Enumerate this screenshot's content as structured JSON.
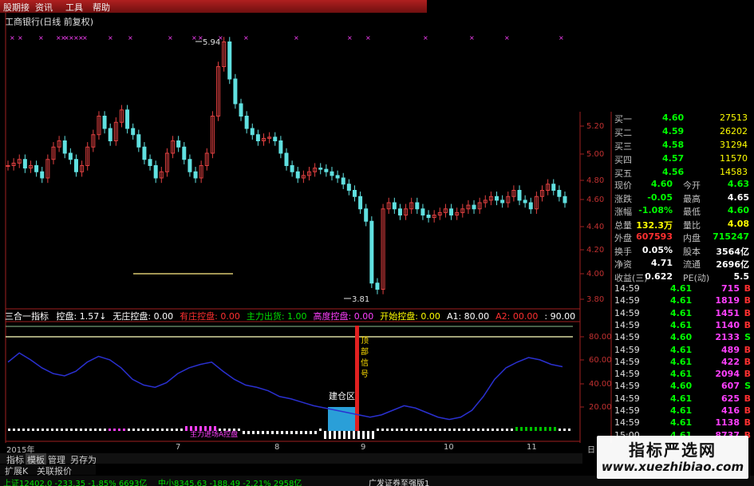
{
  "menu": [
    "股期接",
    "资讯",
    "工具",
    "帮助"
  ],
  "chart": {
    "title": "工商银行(日线 前复权)",
    "price_axis": [
      "5.20",
      "5.00",
      "4.80",
      "4.60",
      "4.40",
      "4.20",
      "4.00",
      "3.80"
    ],
    "high_label": "5.94",
    "low_label": "3.81"
  },
  "indicator": {
    "name": "三合一指标",
    "items": [
      {
        "text": "控盘: 1.57↓",
        "color": "#ffffff"
      },
      {
        "text": "无庄控盘: 0.00",
        "color": "#ffffff"
      },
      {
        "text": "有庄控盘: 0.00",
        "color": "#ff3030"
      },
      {
        "text": "主力出货: 1.00",
        "color": "#00e000"
      },
      {
        "text": "高度控盘: 0.00",
        "color": "#ff40ff"
      },
      {
        "text": "开始控盘: 0.00",
        "color": "#ffff00"
      },
      {
        "text": "A1: 80.00",
        "color": "#ffffff"
      },
      {
        "text": "A2: 00.00",
        "color": "#ff3030"
      },
      {
        "text": ": 90.00",
        "color": "#ffffff"
      }
    ],
    "axis": [
      "80.00",
      "60.00",
      "40.00",
      "20.00"
    ],
    "label_build": "建仓区",
    "label_top": "顶部信号",
    "label_main": "主力进场A控盘"
  },
  "xaxis": [
    "2015年",
    "7",
    "8",
    "9",
    "10",
    "11",
    "日"
  ],
  "bottom_tabs": [
    "指标",
    "模板",
    "管理",
    "另存为"
  ],
  "sub_tabs": [
    "扩展K",
    "关联报价"
  ],
  "status": {
    "sh": "上证12402.0 -233.35 -1.85% 6693亿",
    "sz": "中小8345.63 -188.49 -2.21% 2958亿",
    "broker": "广发证券至强版1"
  },
  "quote": {
    "bids": [
      {
        "label": "买一",
        "price": "4.60",
        "vol": "27513"
      },
      {
        "label": "买二",
        "price": "4.59",
        "vol": "26202"
      },
      {
        "label": "买三",
        "price": "4.58",
        "vol": "31294"
      },
      {
        "label": "买四",
        "price": "4.57",
        "vol": "11570"
      },
      {
        "label": "买五",
        "price": "4.56",
        "vol": "14583"
      }
    ],
    "stats": [
      {
        "l1": "现价",
        "v1": "4.60",
        "l2": "今开",
        "v2": "4.63",
        "c1": "#00ff00",
        "c2": "#00ff00"
      },
      {
        "l1": "涨跌",
        "v1": "-0.05",
        "l2": "最高",
        "v2": "4.65",
        "c1": "#00ff00",
        "c2": "#ffffff"
      },
      {
        "l1": "涨幅",
        "v1": "-1.08%",
        "l2": "最低",
        "v2": "4.60",
        "c1": "#00ff00",
        "c2": "#00ff00"
      },
      {
        "l1": "总量",
        "v1": "132.3万",
        "l2": "量比",
        "v2": "4.08",
        "c1": "#ffff00",
        "c2": "#ffff00"
      },
      {
        "l1": "外盘",
        "v1": "607593",
        "l2": "内盘",
        "v2": "715247",
        "c1": "#ff3030",
        "c2": "#00ff00"
      },
      {
        "l1": "换手",
        "v1": "0.05%",
        "l2": "股本",
        "v2": "3564亿",
        "c1": "#ffffff",
        "c2": "#ffffff"
      },
      {
        "l1": "净资",
        "v1": "4.71",
        "l2": "流通",
        "v2": "2696亿",
        "c1": "#ffffff",
        "c2": "#ffffff"
      },
      {
        "l1": "收益(三)",
        "v1": "0.622",
        "l2": "PE(动)",
        "v2": "5.5",
        "c1": "#ffffff",
        "c2": "#ffffff"
      }
    ],
    "ticks": [
      {
        "t": "14:59",
        "p": "4.61",
        "v": "715",
        "f": "B"
      },
      {
        "t": "14:59",
        "p": "4.61",
        "v": "1819",
        "f": "B"
      },
      {
        "t": "14:59",
        "p": "4.61",
        "v": "1451",
        "f": "B"
      },
      {
        "t": "14:59",
        "p": "4.61",
        "v": "1140",
        "f": "B"
      },
      {
        "t": "14:59",
        "p": "4.60",
        "v": "2133",
        "f": "S"
      },
      {
        "t": "14:59",
        "p": "4.61",
        "v": "489",
        "f": "B"
      },
      {
        "t": "14:59",
        "p": "4.61",
        "v": "422",
        "f": "B"
      },
      {
        "t": "14:59",
        "p": "4.61",
        "v": "2094",
        "f": "B"
      },
      {
        "t": "14:59",
        "p": "4.60",
        "v": "607",
        "f": "S"
      },
      {
        "t": "14:59",
        "p": "4.61",
        "v": "625",
        "f": "B"
      },
      {
        "t": "14:59",
        "p": "4.61",
        "v": "416",
        "f": "B"
      },
      {
        "t": "14:59",
        "p": "4.61",
        "v": "1138",
        "f": "B"
      },
      {
        "t": "15:00",
        "p": "4.61",
        "v": "8737",
        "f": "B"
      }
    ]
  },
  "watermark": {
    "cn": "指标严选网",
    "url": "www.xuezhibiao.com"
  }
}
